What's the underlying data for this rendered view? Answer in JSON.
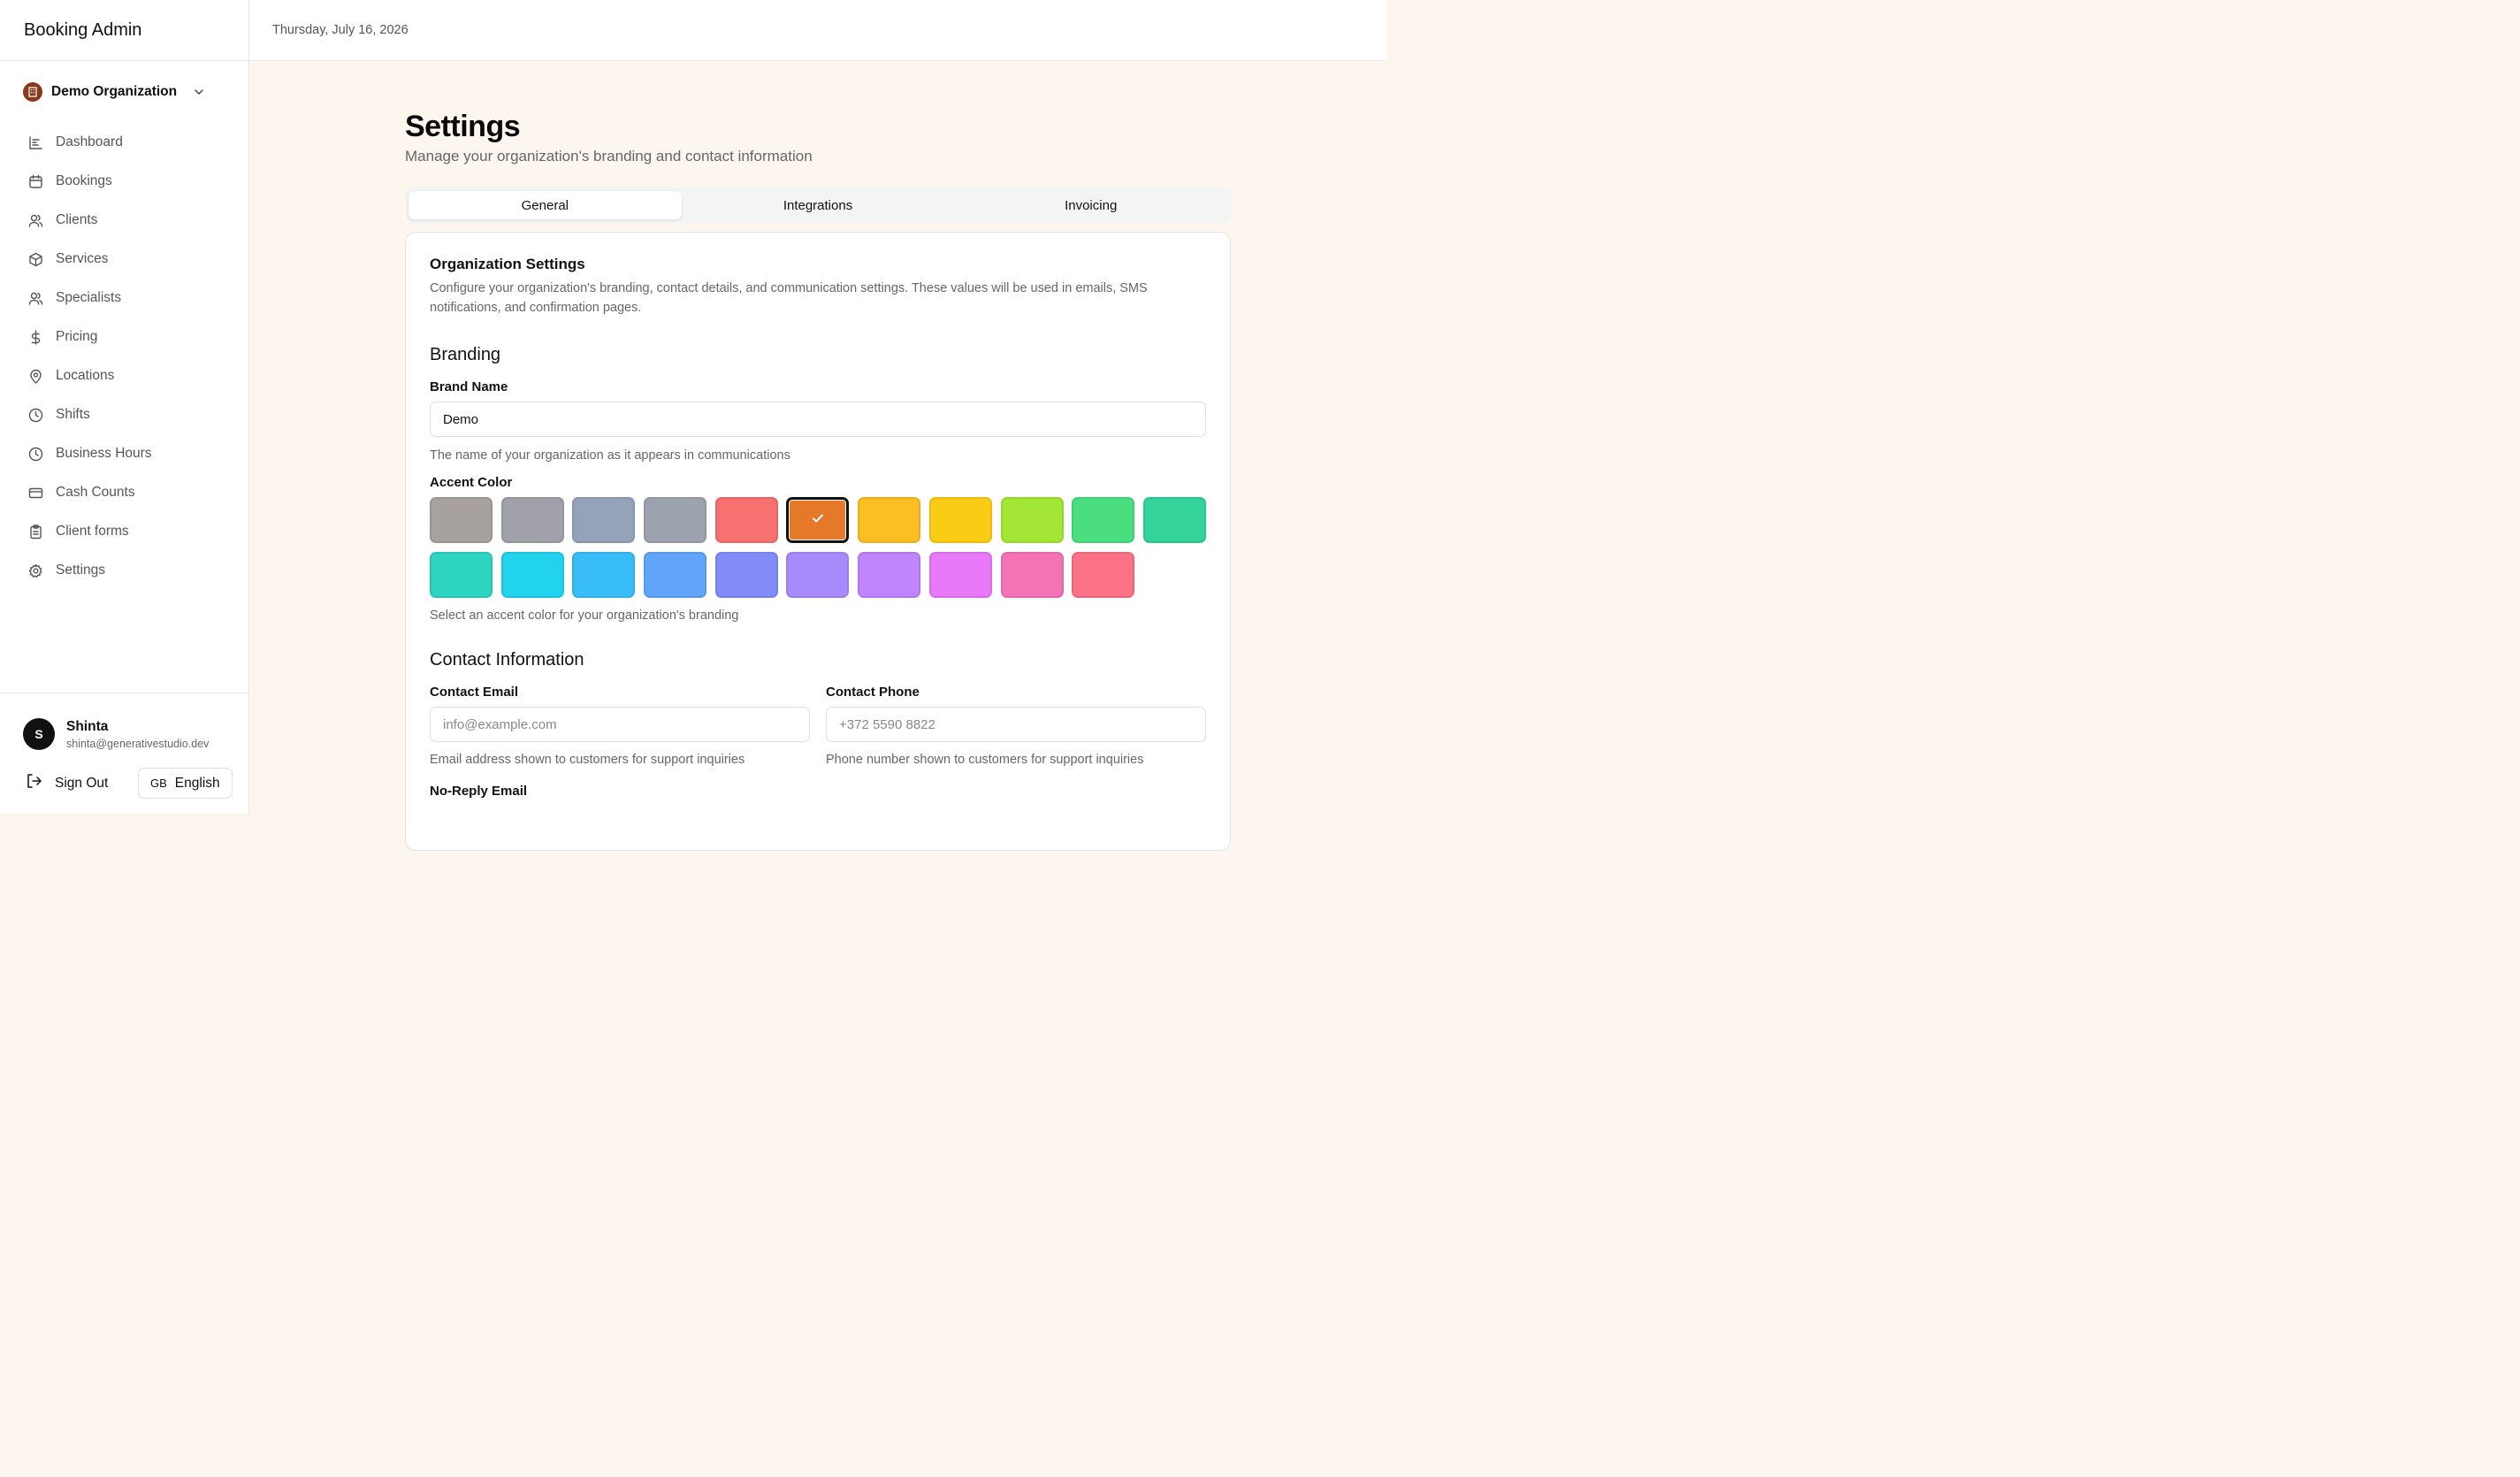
{
  "app": {
    "title": "Booking Admin"
  },
  "header": {
    "date": "Thursday, July 16, 2026"
  },
  "org": {
    "name": "Demo Organization"
  },
  "sidebar": {
    "items": [
      {
        "label": "Dashboard",
        "icon": "chart-icon"
      },
      {
        "label": "Bookings",
        "icon": "calendar-icon"
      },
      {
        "label": "Clients",
        "icon": "users-icon"
      },
      {
        "label": "Services",
        "icon": "box-icon"
      },
      {
        "label": "Specialists",
        "icon": "users-icon"
      },
      {
        "label": "Pricing",
        "icon": "dollar-icon"
      },
      {
        "label": "Locations",
        "icon": "map-pin-icon"
      },
      {
        "label": "Shifts",
        "icon": "clock-icon"
      },
      {
        "label": "Business Hours",
        "icon": "clock-icon"
      },
      {
        "label": "Cash Counts",
        "icon": "credit-card-icon"
      },
      {
        "label": "Client forms",
        "icon": "clipboard-icon"
      },
      {
        "label": "Settings",
        "icon": "gear-icon"
      }
    ]
  },
  "user": {
    "initial": "S",
    "name": "Shinta",
    "email": "shinta@generativestudio.dev"
  },
  "footer": {
    "sign_out": "Sign Out",
    "lang_code": "GB",
    "language": "English"
  },
  "page": {
    "title": "Settings",
    "subtitle": "Manage your organization's branding and contact information"
  },
  "tabs": [
    {
      "label": "General",
      "active": true
    },
    {
      "label": "Integrations",
      "active": false
    },
    {
      "label": "Invoicing",
      "active": false
    }
  ],
  "card": {
    "title": "Organization Settings",
    "description": "Configure your organization's branding, contact details, and communication settings. These values will be used in emails, SMS notifications, and confirmation pages."
  },
  "branding": {
    "title": "Branding",
    "brand_name_label": "Brand Name",
    "brand_name_value": "Demo",
    "brand_name_help": "The name of your organization as it appears in communications",
    "accent_label": "Accent Color",
    "accent_help": "Select an accent color for your organization's branding",
    "selected_index": 5,
    "colors": [
      "#a8a29e",
      "#a1a1aa",
      "#94a3b8",
      "#9ca3af",
      "#f87171",
      "#e6782a",
      "#fbbf24",
      "#facc15",
      "#a3e635",
      "#4ade80",
      "#34d399",
      "#2dd4bf",
      "#22d3ee",
      "#38bdf8",
      "#60a5fa",
      "#818cf8",
      "#a78bfa",
      "#c084fc",
      "#e879f9",
      "#f472b6",
      "#fb7185"
    ]
  },
  "contact": {
    "title": "Contact Information",
    "email_label": "Contact Email",
    "email_placeholder": "info@example.com",
    "email_help": "Email address shown to customers for support inquiries",
    "phone_label": "Contact Phone",
    "phone_placeholder": "+372 5590 8822",
    "phone_help": "Phone number shown to customers for support inquiries",
    "noreply_label": "No-Reply Email"
  }
}
